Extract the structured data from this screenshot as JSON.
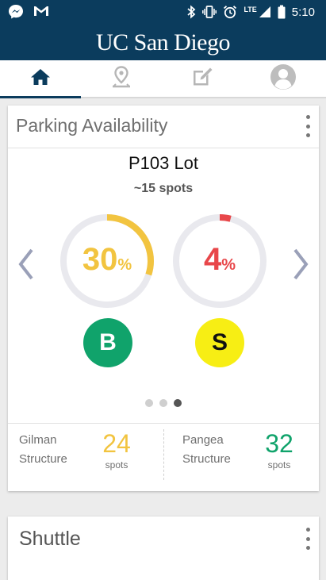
{
  "status_bar": {
    "time": "5:10",
    "network": "LTE",
    "left_icons": [
      "messenger-icon",
      "gmail-icon"
    ],
    "right_icons": [
      "bluetooth-icon",
      "vibrate-icon",
      "alarm-icon",
      "signal-icon",
      "battery-icon"
    ]
  },
  "header": {
    "brand": "UC San Diego"
  },
  "tabs": [
    {
      "name": "home",
      "icon": "home-icon",
      "active": true
    },
    {
      "name": "map",
      "icon": "map-pin-icon",
      "active": false
    },
    {
      "name": "edit",
      "icon": "edit-icon",
      "active": false
    },
    {
      "name": "profile",
      "icon": "profile-icon",
      "active": false
    }
  ],
  "parking": {
    "title": "Parking Availability",
    "lot_name": "P103 Lot",
    "lot_spots": "~15 spots",
    "gauges": [
      {
        "value": "30",
        "unit": "%",
        "fraction": 0.3,
        "color": "#f2c440",
        "permit": "B",
        "permit_bg": "#10a36b",
        "permit_fg": "#ffffff"
      },
      {
        "value": "4",
        "unit": "%",
        "fraction": 0.04,
        "color": "#e8474a",
        "permit": "S",
        "permit_bg": "#f7ee14",
        "permit_fg": "#111111"
      }
    ],
    "pager": {
      "count": 3,
      "active_index": 2
    },
    "structures": [
      {
        "name_line1": "Gilman",
        "name_line2": "Structure",
        "count": "24",
        "unit": "spots",
        "color": "#f2c440"
      },
      {
        "name_line1": "Pangea",
        "name_line2": "Structure",
        "count": "32",
        "unit": "spots",
        "color": "#10a36b"
      }
    ]
  },
  "shuttle": {
    "title": "Shuttle"
  },
  "colors": {
    "primary": "#0b3c5d",
    "ring_track": "#e9e9ee",
    "arrow": "#9aa0b8"
  }
}
